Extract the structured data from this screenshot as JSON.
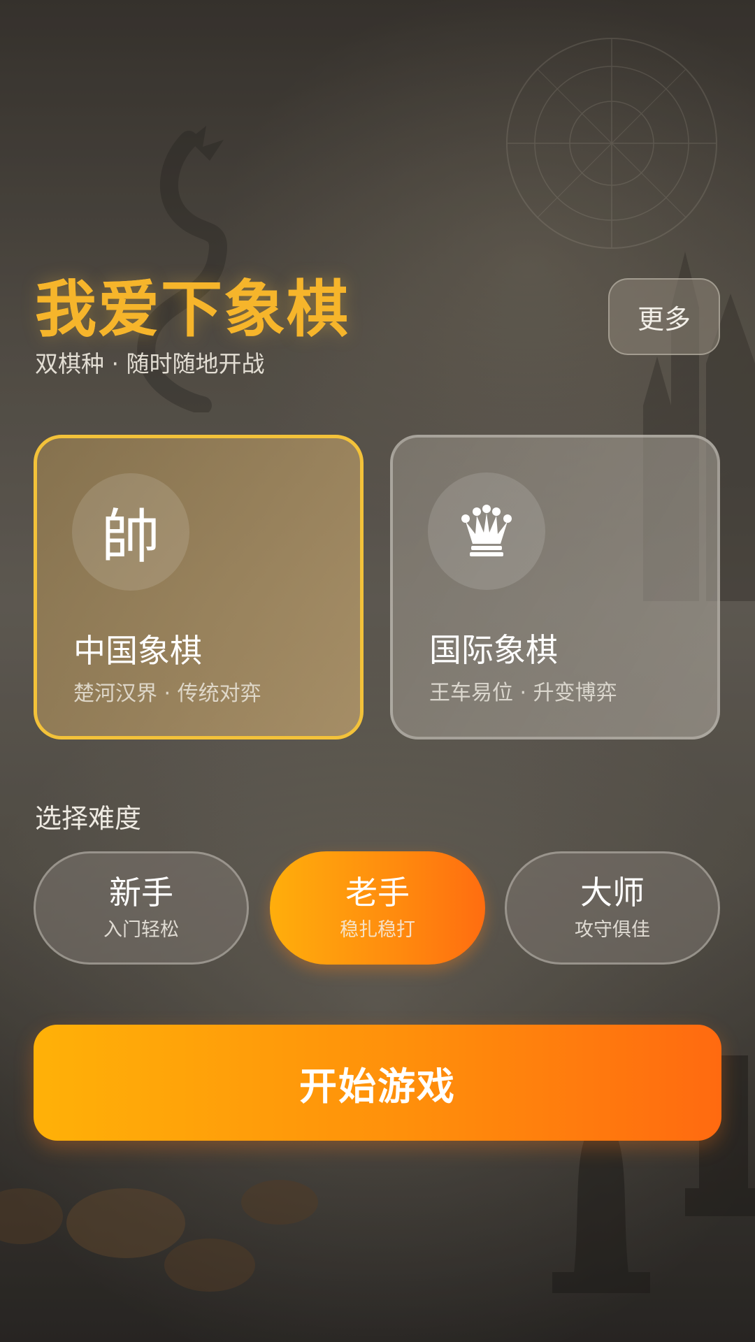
{
  "header": {
    "title": "我爱下象棋",
    "subtitle": "双棋种 · 随时随地开战",
    "more_label": "更多"
  },
  "modes": [
    {
      "name": "中国象棋",
      "desc": "楚河汉界 · 传统对弈",
      "icon_glyph": "帥",
      "icon": "shuai-piece-icon",
      "selected": true
    },
    {
      "name": "国际象棋",
      "desc": "王车易位 · 升变博弈",
      "icon": "queen-crown-icon",
      "selected": false
    }
  ],
  "difficulty": {
    "label": "选择难度",
    "options": [
      {
        "name": "新手",
        "desc": "入门轻松",
        "selected": false
      },
      {
        "name": "老手",
        "desc": "稳扎稳打",
        "selected": true
      },
      {
        "name": "大师",
        "desc": "攻守俱佳",
        "selected": false
      }
    ]
  },
  "start_label": "开始游戏",
  "colors": {
    "title": "#f6b52b",
    "selected_border": "#f3c23a",
    "accent_start": "#ffb108",
    "accent_end": "#ff6a10"
  }
}
